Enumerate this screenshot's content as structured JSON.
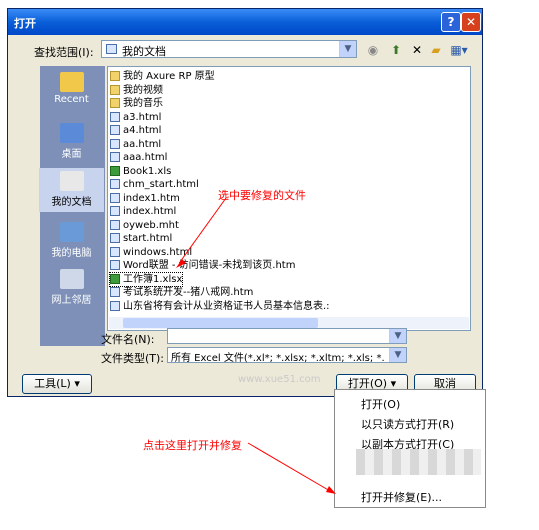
{
  "dialog": {
    "title": "打开",
    "help_button": "?",
    "close_button": "✕",
    "lookin_label": "查找范围(I):",
    "lookin_value": "我的文档",
    "tools_label": "工具(L)",
    "open_label": "打开(O)",
    "cancel_label": "取消",
    "filename_label": "文件名(N):",
    "filename_value": "",
    "filetype_label": "文件类型(T):",
    "filetype_value": "所有 Excel 文件(*.xl*; *.xlsx; *.xltm; *.xls; *."
  },
  "places": [
    {
      "label": "Recent",
      "icon": "recent-icon"
    },
    {
      "label": "桌面",
      "icon": "desktop-icon"
    },
    {
      "label": "我的文档",
      "icon": "my-documents-icon"
    },
    {
      "label": "我的电脑",
      "icon": "my-computer-icon"
    },
    {
      "label": "网上邻居",
      "icon": "network-places-icon"
    }
  ],
  "files": [
    {
      "name": "我的 Axure RP 原型",
      "icon": "folder"
    },
    {
      "name": "我的视频",
      "icon": "folder"
    },
    {
      "name": "我的音乐",
      "icon": "folder"
    },
    {
      "name": "a3.html",
      "icon": "html"
    },
    {
      "name": "a4.html",
      "icon": "html"
    },
    {
      "name": "aa.html",
      "icon": "html"
    },
    {
      "name": "aaa.html",
      "icon": "html"
    },
    {
      "name": "Book1.xls",
      "icon": "xls"
    },
    {
      "name": "chm_start.html",
      "icon": "html"
    },
    {
      "name": "index1.htm",
      "icon": "html"
    },
    {
      "name": "index.html",
      "icon": "html"
    },
    {
      "name": "oyweb.mht",
      "icon": "html"
    },
    {
      "name": "start.html",
      "icon": "html"
    },
    {
      "name": "windows.html",
      "icon": "html"
    },
    {
      "name": "Word联盟 - 访问错误-未找到该页.htm",
      "icon": "html"
    },
    {
      "name": "工作簿1.xlsx",
      "icon": "xls"
    },
    {
      "name": "考试系统开发--猪八戒网.htm",
      "icon": "html"
    },
    {
      "name": "山东省将有会计从业资格证书人员基本信息表.:",
      "icon": "html"
    }
  ],
  "open_menu": [
    "打开(O)",
    "以只读方式打开(R)",
    "以副本方式打开(C)",
    "打开并修复(E)..."
  ],
  "annotations": {
    "select_file": "选中要修复的文件",
    "click_here": "点击这里打开并修复"
  },
  "watermark": "www.xue51.com"
}
